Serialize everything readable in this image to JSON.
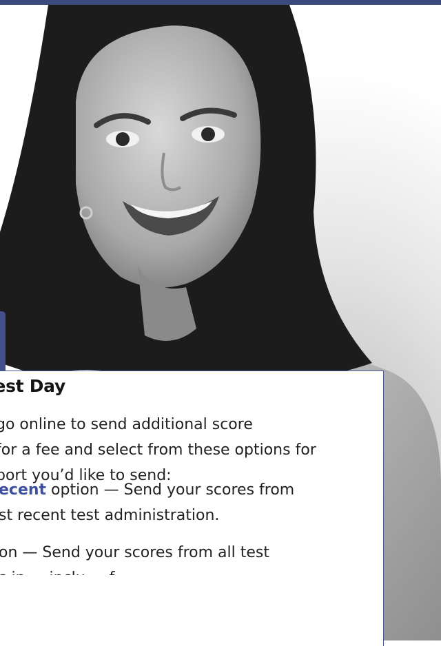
{
  "colors": {
    "accent": "#3b4a7a",
    "keyword": "#3c4fa0",
    "card_border": "#4a5690"
  },
  "photo": {
    "subject": "smiling woman portrait (grayscale photo)"
  },
  "card": {
    "title": "Test Day",
    "intro_lines": [
      "go online to send additional score",
      "for a fee and select from these options for",
      "port you’d like to send:"
    ],
    "option_recent": {
      "keyword": "ecent",
      "line1_rest": " option — Send your scores from",
      "line2": "st recent test administration."
    },
    "option_all": {
      "line1": "on — Send your scores from all test",
      "line2": "s in ... inclu ... f ..."
    }
  }
}
